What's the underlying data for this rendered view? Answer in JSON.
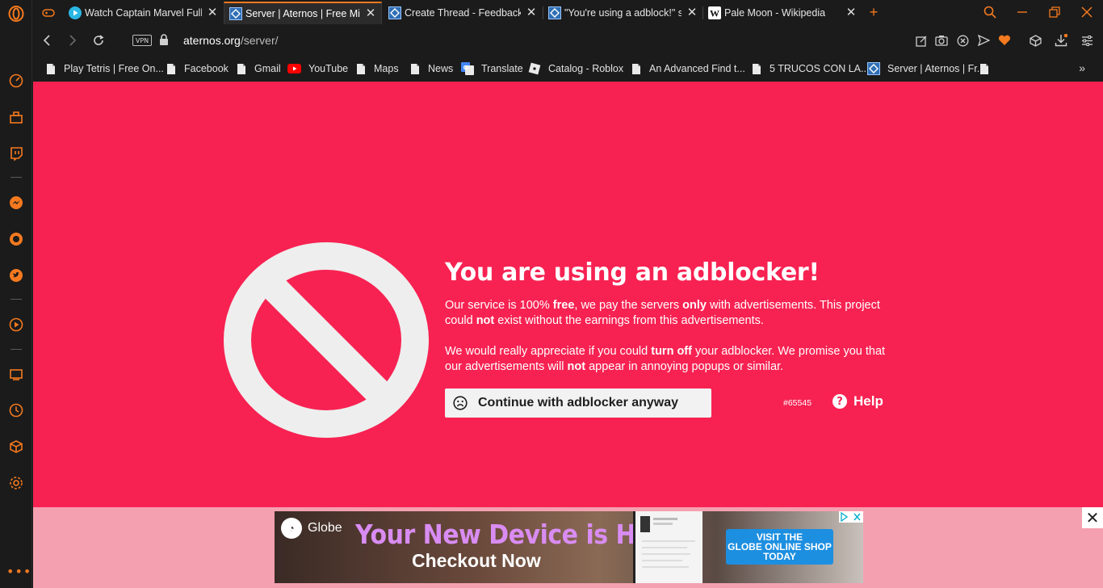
{
  "tabs": [
    {
      "title": "Watch Captain Marvel Full M",
      "icon": "play-circle-icon",
      "active": false
    },
    {
      "title": "Server | Aternos | Free Minec",
      "icon": "aternos-icon",
      "active": true
    },
    {
      "title": "Create Thread - Feedback/S",
      "icon": "aternos-icon",
      "active": false
    },
    {
      "title": "\"You're using a adblock!\" sh",
      "icon": "aternos-icon",
      "active": false
    },
    {
      "title": "Pale Moon - Wikipedia",
      "icon": "wikipedia-icon",
      "active": false
    }
  ],
  "addressbar": {
    "vpn_label": "VPN",
    "url_host": "aternos.org",
    "url_path": "/server/"
  },
  "bookmarks": [
    {
      "label": "Play Tetris | Free On...",
      "icon": "page-icon"
    },
    {
      "label": "Facebook",
      "icon": "page-icon"
    },
    {
      "label": "Gmail",
      "icon": "page-icon"
    },
    {
      "label": "YouTube",
      "icon": "youtube-icon"
    },
    {
      "label": "Maps",
      "icon": "page-icon"
    },
    {
      "label": "News",
      "icon": "page-icon"
    },
    {
      "label": "Translate",
      "icon": "translate-icon"
    },
    {
      "label": "Catalog - Roblox",
      "icon": "roblox-icon"
    },
    {
      "label": "An Advanced Find t...",
      "icon": "page-icon"
    },
    {
      "label": "5 TRUCOS CON LA...",
      "icon": "page-icon"
    },
    {
      "label": "Server | Aternos | Fr...",
      "icon": "aternos-icon"
    },
    {
      "label": "",
      "icon": "page-icon"
    }
  ],
  "bookmarks_more": "»",
  "page": {
    "headline": "You are using an adblocker!",
    "para1": {
      "a": "Our service is 100% ",
      "b": "free",
      "c": ", we pay the servers ",
      "d": "only",
      "e": " with advertisements. This project could ",
      "f": "not",
      "g": " exist without the earnings from this advertisements."
    },
    "para2": {
      "a": "We would really appreciate if you could ",
      "b": "turn off",
      "c": " your adblocker. We promise you that our advertisements will ",
      "d": "not",
      "e": " appear in annoying popups or similar."
    },
    "continue_label": "Continue with adblocker anyway",
    "code": "#65545",
    "help_label": "Help",
    "accent_color": "#f72252"
  },
  "ad": {
    "brand": "Globe",
    "headline": "Your New Device is Here",
    "subline": "Checkout Now",
    "cta_line1": "VISIT THE",
    "cta_line2": "GLOBE ONLINE SHOP",
    "cta_line3": "TODAY",
    "close_glyph": "✕"
  }
}
